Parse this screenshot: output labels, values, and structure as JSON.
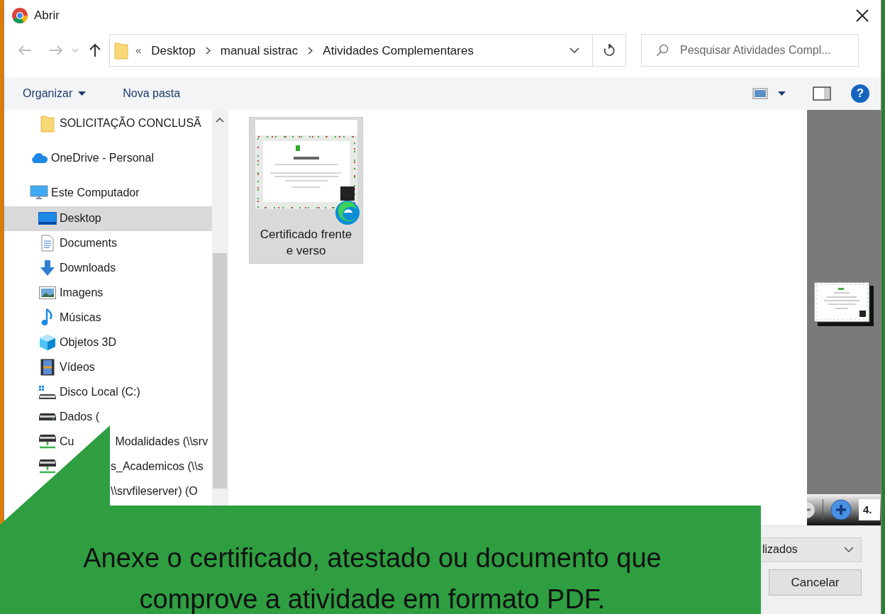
{
  "window": {
    "title": "Abrir"
  },
  "address_bar": {
    "overflow": "«",
    "crumbs": [
      "Desktop",
      "manual sistrac",
      "Atividades Complementares"
    ]
  },
  "search": {
    "placeholder": "Pesquisar Atividades Compl..."
  },
  "toolbar": {
    "organize": "Organizar",
    "new_folder": "Nova pasta",
    "help": "?"
  },
  "sidebar": {
    "overflow_items": [
      {
        "label": "SOLICITAÇÃO CONCLUSÃ",
        "kind": "folder",
        "selected": false
      }
    ],
    "items": [
      {
        "label": "OneDrive - Personal",
        "kind": "cloud",
        "selected": false
      },
      {
        "label": "Este Computador",
        "kind": "computer",
        "selected": false,
        "children": [
          {
            "label": "Desktop",
            "kind": "desktop",
            "selected": true
          },
          {
            "label": "Documents",
            "kind": "document",
            "selected": false
          },
          {
            "label": "Downloads",
            "kind": "download",
            "selected": false
          },
          {
            "label": "Imagens",
            "kind": "picture",
            "selected": false
          },
          {
            "label": "Músicas",
            "kind": "music",
            "selected": false
          },
          {
            "label": "Objetos 3D",
            "kind": "cube",
            "selected": false
          },
          {
            "label": "Vídeos",
            "kind": "film",
            "selected": false
          },
          {
            "label": "Disco Local (C:)",
            "kind": "system-drive",
            "selected": false
          },
          {
            "label": "Dados (",
            "kind": "drive",
            "selected": false
          },
          {
            "label": "Cu",
            "label_after_cover": "Modalidades (\\\\srv",
            "kind": "network",
            "selected": false
          },
          {
            "label_after_cover": "s_Academicos (\\\\s",
            "kind": "network",
            "selected": false
          },
          {
            "label_after_cover": "\\\\srvfileserver) (O",
            "selected": false
          }
        ]
      }
    ]
  },
  "files": [
    {
      "name": "Certificado frente e verso",
      "selected": true
    }
  ],
  "preview": {
    "zoom_field": "4."
  },
  "file_type": {
    "value": "lizados"
  },
  "buttons": [
    {
      "label": "Cancelar"
    }
  ],
  "callout": {
    "text": "Anexe o certificado, atestado ou documento que comprove a atividade em formato PDF."
  }
}
